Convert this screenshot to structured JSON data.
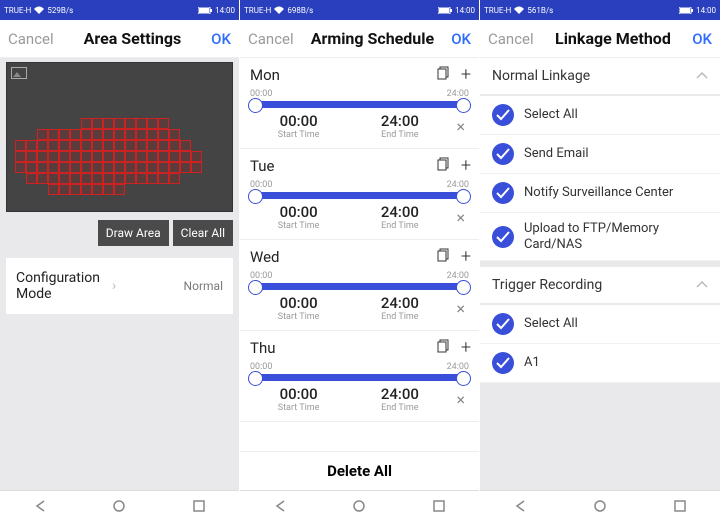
{
  "status": {
    "carrier": "TRUE-H",
    "time": "14:00",
    "speed1": "529B/s",
    "speed2": "698B/s",
    "speed3": "561B/s"
  },
  "common": {
    "cancel": "Cancel",
    "ok": "OK"
  },
  "p1": {
    "title": "Area Settings",
    "draw_area": "Draw Area",
    "clear_all": "Clear All",
    "config_label": "Configuration\nMode",
    "config_value": "Normal"
  },
  "p2": {
    "title": "Arming Schedule",
    "slider_min": "00:00",
    "slider_max": "24:00",
    "start_label": "Start Time",
    "end_label": "End Time",
    "delete_all": "Delete All",
    "days": [
      {
        "name": "Mon",
        "start": "00:00",
        "end": "24:00"
      },
      {
        "name": "Tue",
        "start": "00:00",
        "end": "24:00"
      },
      {
        "name": "Wed",
        "start": "00:00",
        "end": "24:00"
      },
      {
        "name": "Thu",
        "start": "00:00",
        "end": "24:00"
      }
    ]
  },
  "p3": {
    "title": "Linkage Method",
    "sections": [
      {
        "head": "Normal Linkage",
        "items": [
          "Select All",
          "Send Email",
          "Notify Surveillance Center",
          "Upload to FTP/Memory Card/NAS"
        ]
      },
      {
        "head": "Trigger Recording",
        "items": [
          "Select All",
          "A1"
        ]
      }
    ]
  }
}
